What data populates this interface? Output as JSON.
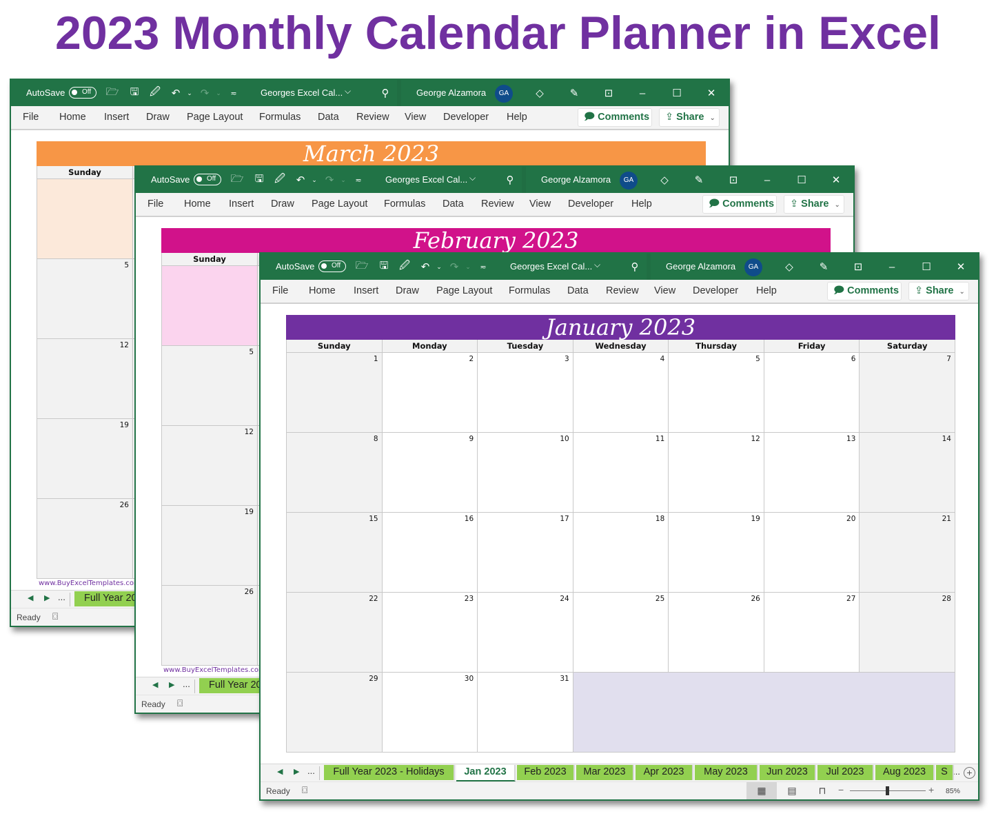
{
  "page_title": "2023 Monthly Calendar Planner in Excel",
  "common": {
    "autosave_label": "AutoSave",
    "autosave_state": "Off",
    "file_name": "Georges Excel Cal...",
    "user_name": "George Alzamora",
    "user_initials": "GA",
    "menu": [
      "File",
      "Home",
      "Insert",
      "Draw",
      "Page Layout",
      "Formulas",
      "Data",
      "Review",
      "View",
      "Developer",
      "Help"
    ],
    "comments_label": "Comments",
    "share_label": "Share",
    "status_ready": "Ready",
    "website": "www.BuyExcelTemplates.com",
    "tab_more": "...",
    "icons": {
      "open": "folder-open-icon",
      "save": "save-icon",
      "save_as": "save-edit-icon",
      "undo": "undo-icon",
      "redo": "redo-icon",
      "customize": "customize-qat-icon",
      "search": "search-icon",
      "premium": "diamond-icon",
      "pen": "pen-icon",
      "ribbon_display": "ribbon-display-icon",
      "minimize": "minimize-icon",
      "maximize": "maximize-icon",
      "close": "close-icon"
    },
    "colors": {
      "excel_green": "#217346",
      "tab_green": "#92d050",
      "title_purple": "#7030a0"
    }
  },
  "windows": {
    "march": {
      "title": "March 2023",
      "header_color": "#f79646",
      "first_cell_color": "#fce9da",
      "visible_day_header": "Sunday",
      "visible_sunday_dates": [
        "",
        "5",
        "12",
        "19",
        "26"
      ],
      "visible_tab": "Full Year 20"
    },
    "february": {
      "title": "February 2023",
      "header_color": "#d1128a",
      "first_cell_color": "#fbd4ee",
      "visible_day_header": "Sunday",
      "visible_sunday_dates": [
        "",
        "5",
        "12",
        "19",
        "26"
      ],
      "visible_tab": "Full Year 20"
    },
    "january": {
      "title": "January 2023",
      "header_color": "#7030a0",
      "blank_cell_color": "#e1dfee",
      "day_headers": [
        "Sunday",
        "Monday",
        "Tuesday",
        "Wednesday",
        "Thursday",
        "Friday",
        "Saturday"
      ],
      "weeks": [
        [
          "1",
          "2",
          "3",
          "4",
          "5",
          "6",
          "7"
        ],
        [
          "8",
          "9",
          "10",
          "11",
          "12",
          "13",
          "14"
        ],
        [
          "15",
          "16",
          "17",
          "18",
          "19",
          "20",
          "21"
        ],
        [
          "22",
          "23",
          "24",
          "25",
          "26",
          "27",
          "28"
        ],
        [
          "29",
          "30",
          "31"
        ]
      ],
      "sheet_tabs": [
        "Full Year 2023 - Holidays",
        "Jan 2023",
        "Feb 2023",
        "Mar 2023",
        "Apr 2023",
        "May 2023",
        "Jun 2023",
        "Jul 2023",
        "Aug 2023",
        "S"
      ],
      "active_tab": "Jan 2023",
      "zoom_level": "85%",
      "zoom_slider_fraction": 0.5
    }
  }
}
